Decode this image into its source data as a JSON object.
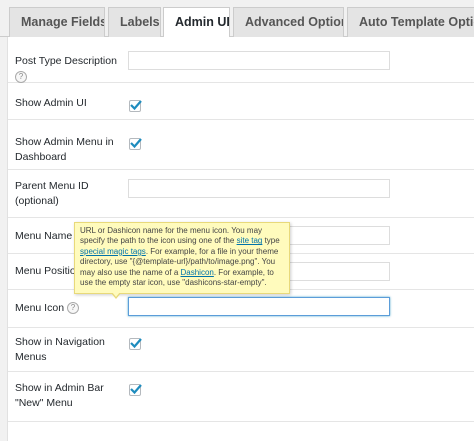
{
  "tabs": [
    {
      "label": "Manage Fields",
      "active": false
    },
    {
      "label": "Labels",
      "active": false
    },
    {
      "label": "Admin UI",
      "active": true
    },
    {
      "label": "Advanced Options",
      "active": false
    },
    {
      "label": "Auto Template Options",
      "active": false
    }
  ],
  "fields": {
    "post_type_description": {
      "label": "Post Type Description",
      "help": "?",
      "value": ""
    },
    "show_admin_ui": {
      "label": "Show Admin UI",
      "checked": true
    },
    "show_admin_menu": {
      "label_line1": "Show Admin Menu in",
      "label_line2": "Dashboard",
      "checked": true
    },
    "parent_menu_id": {
      "label_line1": "Parent Menu ID",
      "label_line2": "(optional)",
      "value": ""
    },
    "menu_name": {
      "label": "Menu Name",
      "value": ""
    },
    "menu_position": {
      "label": "Menu Position",
      "value": ""
    },
    "menu_icon": {
      "label": "Menu Icon",
      "help": "?",
      "value": ""
    },
    "show_in_nav_menus": {
      "label_line1": "Show in Navigation",
      "label_line2": "Menus",
      "checked": true
    },
    "show_in_admin_bar": {
      "label_line1": "Show in Admin Bar",
      "label_line2": "\"New\" Menu",
      "checked": true
    }
  },
  "tooltip": {
    "text_1": "URL or Dashicon name for the menu icon. You may specify the path to the icon using one of the ",
    "link_site_tag": "site tag",
    "text_2": " type ",
    "link_magic_tags": "special magic tags",
    "text_3": ". For example, for a file in your theme directory, use \"{@template-url}/path/to/image.png\". You may also use the name of a ",
    "link_dashicon": "Dashicon",
    "text_4": ". For example, to use the empty star icon, use \"dashicons-star-empty\"."
  },
  "colors": {
    "accent": "#0073aa",
    "checkmark": "#1e8cbe",
    "tooltip_bg": "#fffbbd",
    "focus_border": "#5b9dd9"
  }
}
